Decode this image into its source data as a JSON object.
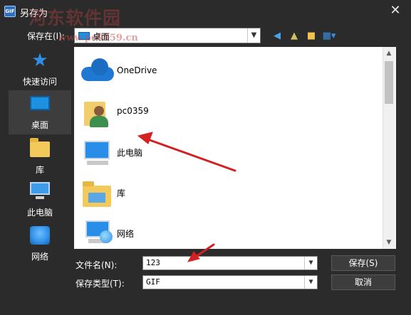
{
  "window": {
    "title": "另存为",
    "app_icon_text": "GIF",
    "close_glyph": "✕"
  },
  "watermark": {
    "line1": "河东软件园",
    "line2": "www.pc0359.cn"
  },
  "toolbar": {
    "save_in_label": "保存在(I):",
    "save_in_value": "桌面",
    "back_icon": "back-arrow-icon",
    "up_icon": "up-folder-icon",
    "new_folder_icon": "new-folder-icon",
    "view_menu_icon": "view-menu-icon"
  },
  "places": [
    {
      "label": "快速访问",
      "icon": "star-icon"
    },
    {
      "label": "桌面",
      "icon": "desktop-icon",
      "selected": true
    },
    {
      "label": "库",
      "icon": "library-icon"
    },
    {
      "label": "此电脑",
      "icon": "computer-icon"
    },
    {
      "label": "网络",
      "icon": "network-icon"
    }
  ],
  "files": [
    {
      "name": "OneDrive",
      "icon": "onedrive-icon"
    },
    {
      "name": "pc0359",
      "icon": "user-folder-icon"
    },
    {
      "name": "此电脑",
      "icon": "computer-icon"
    },
    {
      "name": "库",
      "icon": "library-icon"
    },
    {
      "name": "网络",
      "icon": "network-icon"
    }
  ],
  "form": {
    "filename_label": "文件名(N):",
    "filename_value": "123",
    "filetype_label": "保存类型(T):",
    "filetype_value": "GIF",
    "save_label": "保存(S)",
    "cancel_label": "取消"
  },
  "colors": {
    "background": "#2b2b2b",
    "accent": "#1e90e0",
    "annotation_arrow": "#d42020"
  }
}
